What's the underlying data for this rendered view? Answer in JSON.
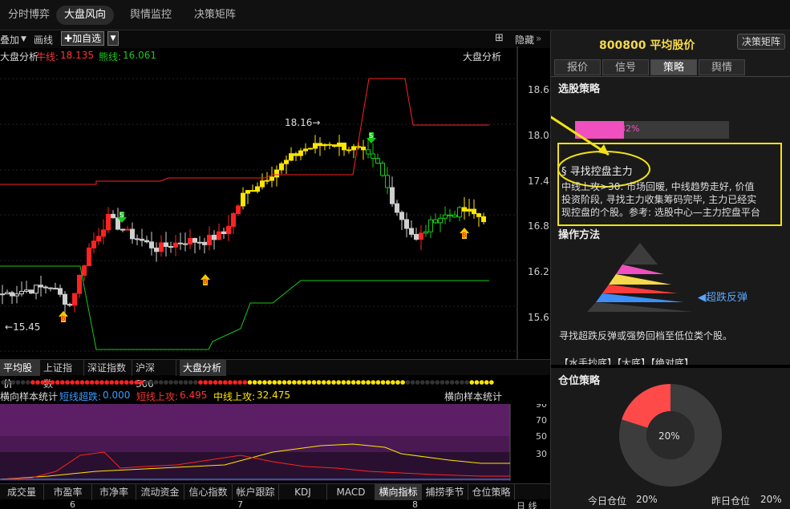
{
  "top_tabs": [
    "分时博弈",
    "大盘风向",
    "舆情监控",
    "决策矩阵"
  ],
  "toolbar": {
    "overlay": "叠加",
    "draw": "画线",
    "add_watch": "加自选",
    "hide": "隐藏"
  },
  "kline_info": {
    "title": "大盘分析",
    "bull_label": "牛线:",
    "bull_value": "18.135",
    "bear_label": "熊线:",
    "bear_value": "16.061",
    "right_title": "大盘分析"
  },
  "price_axis": [
    "18.6",
    "18.0",
    "17.4",
    "16.8",
    "16.2",
    "15.6"
  ],
  "annotations": {
    "high": "18.16",
    "low": "15.45",
    "buy": "B",
    "sell": "S"
  },
  "index_tabs": [
    {
      "label": "平均股价",
      "active": true
    },
    {
      "label": "上证指数",
      "active": false
    },
    {
      "label": "深证指数",
      "active": false
    },
    {
      "label": "沪深300",
      "active": false
    },
    {
      "label": "大盘分析",
      "active": true
    }
  ],
  "indicator": {
    "title": "横向样本统计",
    "short_drop_label": "短线超跌:",
    "short_drop_value": "0.000",
    "short_up_label": "短线上攻:",
    "short_up_value": "6.495",
    "mid_up_label": "中线上攻:",
    "mid_up_value": "32.475",
    "right_title": "横向样本统计",
    "axis": [
      "90",
      "70",
      "50",
      "30"
    ]
  },
  "bottom_tabs": [
    {
      "label": "成交量",
      "active": false
    },
    {
      "label": "市盈率",
      "active": false
    },
    {
      "label": "市净率",
      "active": false
    },
    {
      "label": "流动资金",
      "active": false
    },
    {
      "label": "信心指数",
      "active": false
    },
    {
      "label": "帐户跟踪",
      "active": false
    },
    {
      "label": "KDJ",
      "active": false
    },
    {
      "label": "MACD",
      "active": false
    },
    {
      "label": "横向指标",
      "active": true
    },
    {
      "label": "捕捞季节",
      "active": false
    },
    {
      "label": "仓位策略",
      "active": false
    }
  ],
  "dates": [
    "6",
    "7",
    "8",
    "日 线"
  ],
  "right": {
    "title": "800800 平均股价",
    "matrix_button": "决策矩阵",
    "tabs": [
      {
        "label": "报价",
        "active": false
      },
      {
        "label": "信号",
        "active": false
      },
      {
        "label": "策略",
        "active": true
      },
      {
        "label": "舆情",
        "active": false
      }
    ],
    "pick_title": "选股策略",
    "progress_pct": 32,
    "progress_label": "32%",
    "strategy_name": "§ 寻找控盘主力",
    "strategy_lines": [
      "中线上攻>30: 市场回暖, 中线趋势走好, 价值",
      "投资阶段, 寻找主力收集筹码完毕, 主力已经实",
      "现控盘的个股。参考: 选股中心—主力控盘平台"
    ],
    "method_title": "操作方法",
    "pyramid_label": "◀超跌反弹",
    "method_desc": "寻找超跌反弹或强势回档至低位类个股。",
    "method_tags": "【水手抄底】【大底】【绝对底】",
    "position_title": "仓位策略",
    "donut_label": "20%",
    "today_label": "今日仓位",
    "today_value": "20%",
    "yesterday_label": "昨日仓位",
    "yesterday_value": "20%"
  },
  "colors": {
    "up": "#ff2222",
    "down": "#cfcfcf",
    "bull": "#ff2222",
    "bear": "#19c919",
    "yellow": "#ffe600",
    "pink": "#f04fbf"
  }
}
